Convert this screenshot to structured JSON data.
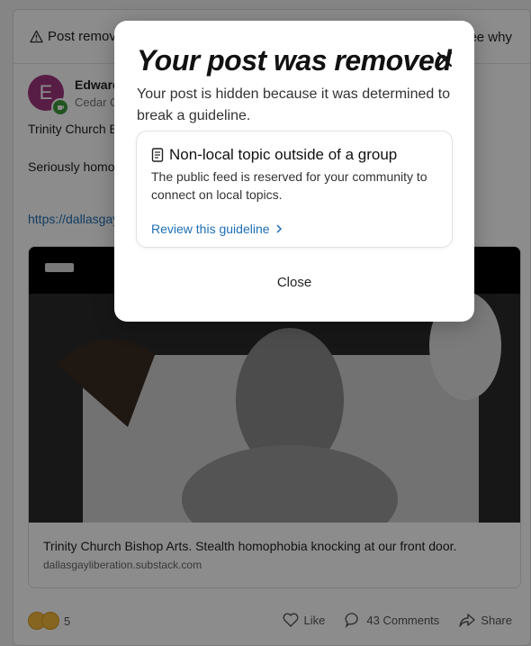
{
  "background": {
    "removed_bar": {
      "label": "Post removed",
      "see_why": "See why"
    },
    "author": {
      "initial": "E",
      "name": "Edward",
      "location": "Cedar C"
    },
    "post": {
      "title": "Trinity Church Bishop Arts",
      "body": "Seriously homophobia... the idea that people are going to hell has open...",
      "link": "https://dallasgayliberation.substack.com"
    },
    "preview": {
      "title": "Trinity Church Bishop Arts. Stealth homophobia knocking at our front door.",
      "domain": "dallasgayliberation.substack.com"
    },
    "footer": {
      "reaction_count": "5",
      "like": "Like",
      "comments": "43 Comments",
      "share": "Share"
    }
  },
  "modal": {
    "title": "Your post was removed",
    "description": "Your post is hidden because it was determined to break a guideline.",
    "guideline": {
      "heading": "Non-local topic outside of a group",
      "body": "The public feed is reserved for your community to connect on local topics.",
      "link": "Review this guideline"
    },
    "close_label": "Close"
  },
  "colors": {
    "link": "#1f6fb5",
    "avatar": "#a0357f",
    "badge": "#3c9a3c"
  },
  "icons": [
    "warning-icon",
    "close-icon",
    "document-icon",
    "chevron-right-icon",
    "like-icon",
    "comment-icon",
    "share-icon"
  ]
}
